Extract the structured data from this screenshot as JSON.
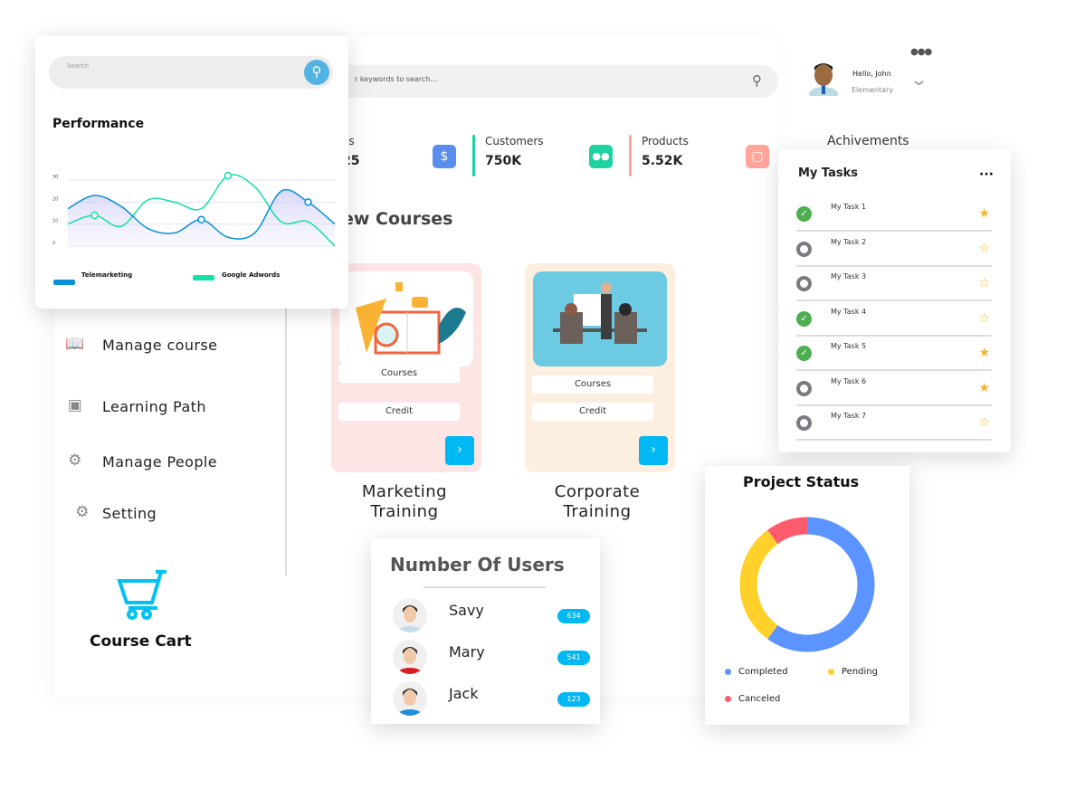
{
  "header": {
    "search_placeholder": "r keywords to search...",
    "user_greeting": "Hello, John",
    "user_role": "Elementary",
    "more_icon": "dots-icon"
  },
  "stats": [
    {
      "label": "es",
      "value": "25",
      "icon": "dollar-icon",
      "color": "#5b8def"
    },
    {
      "label": "Customers",
      "value": "750K",
      "icon": "users-icon",
      "color": "#1dd1a1",
      "bar": "#1dd1a1"
    },
    {
      "label": "Products",
      "value": "5.52K",
      "icon": "bag-icon",
      "color": "#ffa59a",
      "bar": "#ffa59a"
    }
  ],
  "achievements_label": "Achivements",
  "courses": {
    "heading": "ew Courses",
    "items": [
      {
        "title_line1": "Marketing",
        "title_line2": "Training",
        "courses": "Courses",
        "credit": "Credit",
        "bg": "#fde5e5"
      },
      {
        "title_line1": "Corporate",
        "title_line2": "Training",
        "courses": "Courses",
        "credit": "Credit",
        "bg": "#fdefdf"
      }
    ]
  },
  "sidebar": {
    "items": [
      {
        "label": "Manage course",
        "icon": "book-reader-icon"
      },
      {
        "label": "Learning Path",
        "icon": "teacher-icon"
      },
      {
        "label": "Manage People",
        "icon": "people-gear-icon"
      },
      {
        "label": "Setting",
        "icon": "gear-icon"
      }
    ],
    "cart_label": "Course Cart",
    "cart_color": "#00c2f3"
  },
  "performance": {
    "search_placeholder": "Search",
    "title": "Performance"
  },
  "chart_data": [
    {
      "type": "line",
      "title": "Performance",
      "x": [
        0,
        1,
        2,
        3,
        4,
        5,
        6,
        7,
        8,
        9,
        10
      ],
      "ylim": [
        0,
        30
      ],
      "yticks": [
        "0",
        "10",
        "20",
        "30"
      ],
      "grid": true,
      "legend": "bottom",
      "series": [
        {
          "name": "Telemarketing",
          "color": "#0a8fd8",
          "values": [
            17,
            23,
            18,
            8,
            6,
            12,
            4,
            6,
            25,
            20,
            10
          ]
        },
        {
          "name": "Google Adwords",
          "color": "#14e0a8",
          "values": [
            10,
            14,
            9,
            21,
            20,
            17,
            32,
            27,
            11,
            11,
            0
          ]
        }
      ]
    },
    {
      "type": "pie",
      "title": "Project Status",
      "categories": [
        "Completed",
        "Pending",
        "Canceled"
      ],
      "values": [
        60,
        30,
        10
      ],
      "colors": [
        "#5b94ff",
        "#ffd12a",
        "#ff5b6e"
      ],
      "legend": "bottom"
    }
  ],
  "tasks": {
    "title": "My Tasks",
    "items": [
      {
        "label": "My Task  1",
        "done": true,
        "starred": true
      },
      {
        "label": "My Task  2",
        "done": false,
        "starred": false
      },
      {
        "label": "My Task  3",
        "done": false,
        "starred": false
      },
      {
        "label": "My Task  4",
        "done": true,
        "starred": false
      },
      {
        "label": "My Task  5",
        "done": true,
        "starred": true
      },
      {
        "label": "My Task  6",
        "done": false,
        "starred": true
      },
      {
        "label": "My Task  7",
        "done": false,
        "starred": false
      }
    ]
  },
  "users": {
    "title": "Number Of Users",
    "items": [
      {
        "name": "Savy",
        "count": "634"
      },
      {
        "name": "Mary",
        "count": "541"
      },
      {
        "name": "Jack",
        "count": "123"
      }
    ]
  }
}
